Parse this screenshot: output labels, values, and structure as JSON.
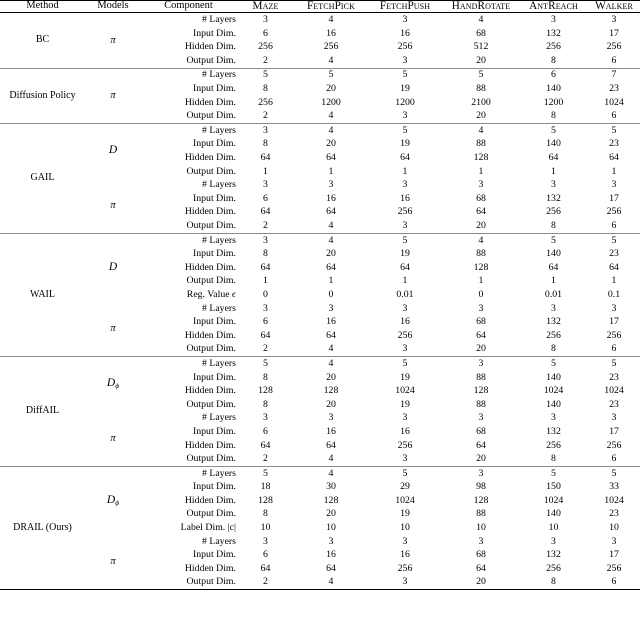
{
  "table": {
    "caption": "",
    "columns": {
      "method": "Method",
      "models": "Models",
      "component": "Component",
      "environments": [
        "Maze",
        "FetchPick",
        "FetchPush",
        "HandRotate",
        "AntReach",
        "Walker"
      ]
    },
    "components": {
      "layers": "# Layers",
      "input_dim": "Input Dim.",
      "hidden_dim": "Hidden Dim.",
      "output_dim": "Output Dim.",
      "reg_value": "Reg. Value",
      "reg_value_symbol": "ϵ",
      "label_dim": "Label Dim.",
      "label_dim_symbol": "|c|"
    },
    "model_symbols": {
      "policy": "π",
      "discriminator": "D",
      "discriminator_phi_base": "D",
      "discriminator_phi_sub": "ϕ"
    },
    "sections": [
      {
        "method": "BC",
        "blocks": [
          {
            "model": "π",
            "model_type": "policy",
            "rows": [
              {
                "component": "# Layers",
                "values": [
                  "3",
                  "4",
                  "3",
                  "4",
                  "3",
                  "3"
                ]
              },
              {
                "component": "Input Dim.",
                "values": [
                  "6",
                  "16",
                  "16",
                  "68",
                  "132",
                  "17"
                ]
              },
              {
                "component": "Hidden Dim.",
                "values": [
                  "256",
                  "256",
                  "256",
                  "512",
                  "256",
                  "256"
                ]
              },
              {
                "component": "Output Dim.",
                "values": [
                  "2",
                  "4",
                  "3",
                  "20",
                  "8",
                  "6"
                ]
              }
            ]
          }
        ]
      },
      {
        "method": "Diffusion Policy",
        "blocks": [
          {
            "model": "π",
            "model_type": "policy",
            "rows": [
              {
                "component": "# Layers",
                "values": [
                  "5",
                  "5",
                  "5",
                  "5",
                  "6",
                  "7"
                ]
              },
              {
                "component": "Input Dim.",
                "values": [
                  "8",
                  "20",
                  "19",
                  "88",
                  "140",
                  "23"
                ]
              },
              {
                "component": "Hidden Dim.",
                "values": [
                  "256",
                  "1200",
                  "1200",
                  "2100",
                  "1200",
                  "1024"
                ]
              },
              {
                "component": "Output Dim.",
                "values": [
                  "2",
                  "4",
                  "3",
                  "20",
                  "8",
                  "6"
                ]
              }
            ]
          }
        ]
      },
      {
        "method": "GAIL",
        "blocks": [
          {
            "model": "D",
            "model_type": "discriminator",
            "rows": [
              {
                "component": "# Layers",
                "values": [
                  "3",
                  "4",
                  "5",
                  "4",
                  "5",
                  "5"
                ]
              },
              {
                "component": "Input Dim.",
                "values": [
                  "8",
                  "20",
                  "19",
                  "88",
                  "140",
                  "23"
                ]
              },
              {
                "component": "Hidden Dim.",
                "values": [
                  "64",
                  "64",
                  "64",
                  "128",
                  "64",
                  "64"
                ]
              },
              {
                "component": "Output Dim.",
                "values": [
                  "1",
                  "1",
                  "1",
                  "1",
                  "1",
                  "1"
                ]
              }
            ]
          },
          {
            "model": "π",
            "model_type": "policy",
            "rows": [
              {
                "component": "# Layers",
                "values": [
                  "3",
                  "3",
                  "3",
                  "3",
                  "3",
                  "3"
                ]
              },
              {
                "component": "Input Dim.",
                "values": [
                  "6",
                  "16",
                  "16",
                  "68",
                  "132",
                  "17"
                ]
              },
              {
                "component": "Hidden Dim.",
                "values": [
                  "64",
                  "64",
                  "256",
                  "64",
                  "256",
                  "256"
                ]
              },
              {
                "component": "Output Dim.",
                "values": [
                  "2",
                  "4",
                  "3",
                  "20",
                  "8",
                  "6"
                ]
              }
            ]
          }
        ]
      },
      {
        "method": "WAIL",
        "blocks": [
          {
            "model": "D",
            "model_type": "discriminator",
            "rows": [
              {
                "component": "# Layers",
                "values": [
                  "3",
                  "4",
                  "5",
                  "4",
                  "5",
                  "5"
                ]
              },
              {
                "component": "Input Dim.",
                "values": [
                  "8",
                  "20",
                  "19",
                  "88",
                  "140",
                  "23"
                ]
              },
              {
                "component": "Hidden Dim.",
                "values": [
                  "64",
                  "64",
                  "64",
                  "128",
                  "64",
                  "64"
                ]
              },
              {
                "component": "Output Dim.",
                "values": [
                  "1",
                  "1",
                  "1",
                  "1",
                  "1",
                  "1"
                ]
              },
              {
                "component": "Reg. Value ϵ",
                "values": [
                  "0",
                  "0",
                  "0.01",
                  "0",
                  "0.01",
                  "0.1"
                ]
              }
            ]
          },
          {
            "model": "π",
            "model_type": "policy",
            "rows": [
              {
                "component": "# Layers",
                "values": [
                  "3",
                  "3",
                  "3",
                  "3",
                  "3",
                  "3"
                ]
              },
              {
                "component": "Input Dim.",
                "values": [
                  "6",
                  "16",
                  "16",
                  "68",
                  "132",
                  "17"
                ]
              },
              {
                "component": "Hidden Dim.",
                "values": [
                  "64",
                  "64",
                  "256",
                  "64",
                  "256",
                  "256"
                ]
              },
              {
                "component": "Output Dim.",
                "values": [
                  "2",
                  "4",
                  "3",
                  "20",
                  "8",
                  "6"
                ]
              }
            ]
          }
        ]
      },
      {
        "method": "DiffAIL",
        "blocks": [
          {
            "model": "Dϕ",
            "model_type": "discriminator_phi",
            "rows": [
              {
                "component": "# Layers",
                "values": [
                  "5",
                  "4",
                  "5",
                  "3",
                  "5",
                  "5"
                ]
              },
              {
                "component": "Input Dim.",
                "values": [
                  "8",
                  "20",
                  "19",
                  "88",
                  "140",
                  "23"
                ]
              },
              {
                "component": "Hidden Dim.",
                "values": [
                  "128",
                  "128",
                  "1024",
                  "128",
                  "1024",
                  "1024"
                ]
              },
              {
                "component": "Output Dim.",
                "values": [
                  "8",
                  "20",
                  "19",
                  "88",
                  "140",
                  "23"
                ]
              }
            ]
          },
          {
            "model": "π",
            "model_type": "policy",
            "rows": [
              {
                "component": "# Layers",
                "values": [
                  "3",
                  "3",
                  "3",
                  "3",
                  "3",
                  "3"
                ]
              },
              {
                "component": "Input Dim.",
                "values": [
                  "6",
                  "16",
                  "16",
                  "68",
                  "132",
                  "17"
                ]
              },
              {
                "component": "Hidden Dim.",
                "values": [
                  "64",
                  "64",
                  "256",
                  "64",
                  "256",
                  "256"
                ]
              },
              {
                "component": "Output Dim.",
                "values": [
                  "2",
                  "4",
                  "3",
                  "20",
                  "8",
                  "6"
                ]
              }
            ]
          }
        ]
      },
      {
        "method": "DRAIL (Ours)",
        "blocks": [
          {
            "model": "Dϕ",
            "model_type": "discriminator_phi",
            "rows": [
              {
                "component": "# Layers",
                "values": [
                  "5",
                  "4",
                  "5",
                  "3",
                  "5",
                  "5"
                ]
              },
              {
                "component": "Input Dim.",
                "values": [
                  "18",
                  "30",
                  "29",
                  "98",
                  "150",
                  "33"
                ]
              },
              {
                "component": "Hidden Dim.",
                "values": [
                  "128",
                  "128",
                  "1024",
                  "128",
                  "1024",
                  "1024"
                ]
              },
              {
                "component": "Output Dim.",
                "values": [
                  "8",
                  "20",
                  "19",
                  "88",
                  "140",
                  "23"
                ]
              },
              {
                "component": "Label Dim. |c|",
                "values": [
                  "10",
                  "10",
                  "10",
                  "10",
                  "10",
                  "10"
                ]
              }
            ]
          },
          {
            "model": "π",
            "model_type": "policy",
            "rows": [
              {
                "component": "# Layers",
                "values": [
                  "3",
                  "3",
                  "3",
                  "3",
                  "3",
                  "3"
                ]
              },
              {
                "component": "Input Dim.",
                "values": [
                  "6",
                  "16",
                  "16",
                  "68",
                  "132",
                  "17"
                ]
              },
              {
                "component": "Hidden Dim.",
                "values": [
                  "64",
                  "64",
                  "256",
                  "64",
                  "256",
                  "256"
                ]
              },
              {
                "component": "Output Dim.",
                "values": [
                  "2",
                  "4",
                  "3",
                  "20",
                  "8",
                  "6"
                ]
              }
            ]
          }
        ]
      }
    ]
  }
}
